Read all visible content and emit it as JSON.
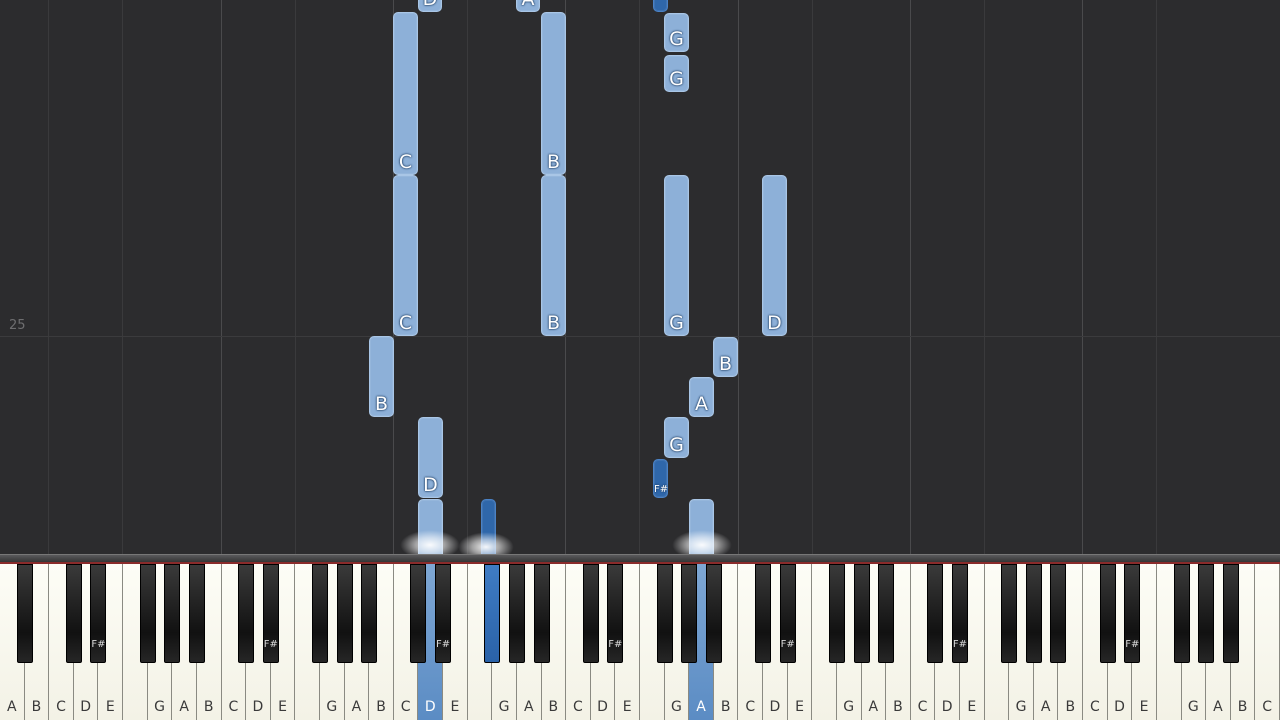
{
  "measure_number": "25",
  "colors": {
    "note_light": "#8db0d8",
    "note_dark": "#2f67aa",
    "background": "#2c2c2e",
    "active_key": "#6a98cc"
  },
  "notes": [
    {
      "label": "D",
      "type": "light"
    },
    {
      "label": "A",
      "type": "light"
    },
    {
      "label": "",
      "type": "dark"
    },
    {
      "label": "C",
      "type": "light"
    },
    {
      "label": "B",
      "type": "light"
    },
    {
      "label": "G",
      "type": "light"
    },
    {
      "label": "G",
      "type": "light"
    },
    {
      "label": "C",
      "type": "light"
    },
    {
      "label": "B",
      "type": "light"
    },
    {
      "label": "G",
      "type": "light"
    },
    {
      "label": "D",
      "type": "light"
    },
    {
      "label": "B",
      "type": "light"
    },
    {
      "label": "B",
      "type": "light"
    },
    {
      "label": "A",
      "type": "light"
    },
    {
      "label": "G",
      "type": "light"
    },
    {
      "label": "D",
      "type": "light"
    },
    {
      "label": "F#",
      "type": "dark"
    },
    {
      "label": "",
      "type": "light"
    },
    {
      "label": "",
      "type": "dark"
    },
    {
      "label": "",
      "type": "light"
    }
  ],
  "white_keys": [
    "A",
    "B",
    "C",
    "D",
    "E",
    "",
    "G",
    "A",
    "B",
    "C",
    "D",
    "E",
    "",
    "G",
    "A",
    "B",
    "C",
    "D",
    "E",
    "",
    "G",
    "A",
    "B",
    "C",
    "D",
    "E",
    "",
    "G",
    "A",
    "B",
    "C",
    "D",
    "E",
    "",
    "G",
    "A",
    "B",
    "C",
    "D",
    "E",
    "",
    "G",
    "A",
    "B",
    "C",
    "D",
    "E",
    "",
    "G",
    "A",
    "B",
    "C"
  ],
  "black_key_labels": [
    "",
    "",
    "F#",
    "",
    "",
    "",
    "",
    "F#",
    "",
    "",
    "",
    "",
    "F#",
    "",
    "",
    "",
    "",
    "F#",
    "",
    "",
    "",
    "",
    "F#",
    "",
    "",
    "",
    "",
    "F#",
    "",
    "",
    "",
    "",
    "F#",
    ""
  ],
  "active_white_keys": [
    17,
    28
  ],
  "active_black_keys": [
    13
  ]
}
